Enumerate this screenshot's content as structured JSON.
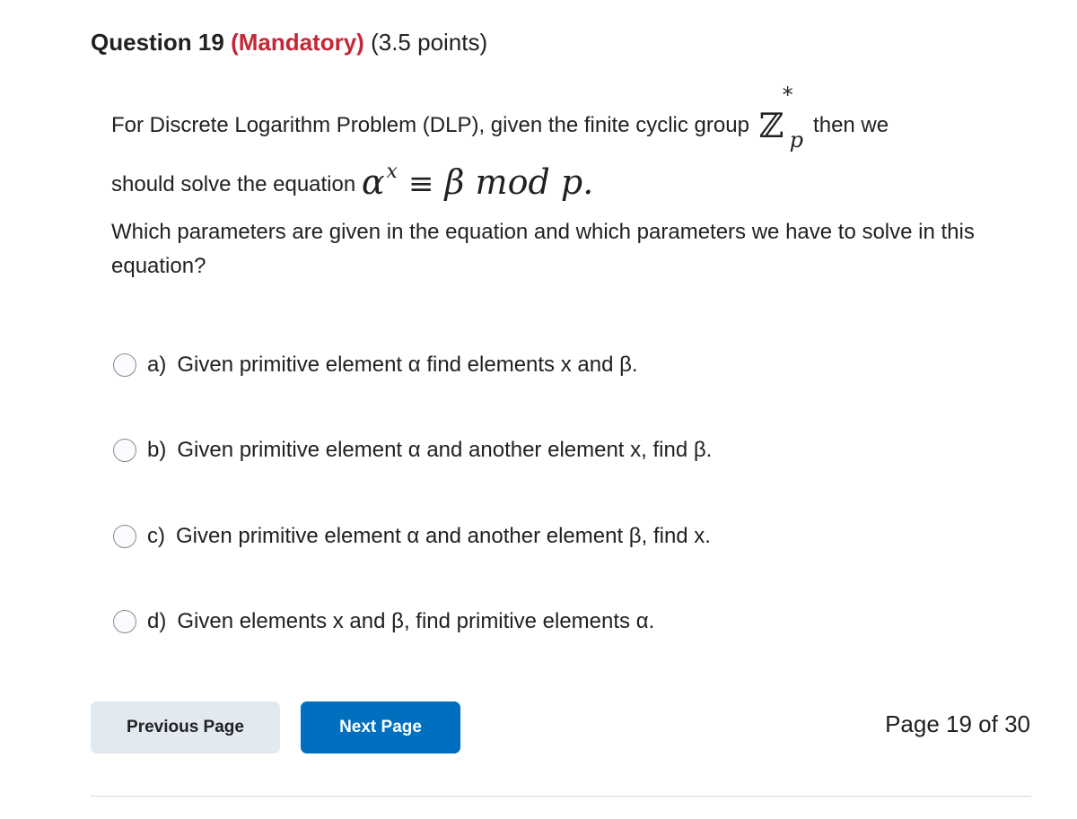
{
  "question": {
    "number_label": "Question 19",
    "mandatory_label": "(Mandatory)",
    "points_label": "(3.5 points)",
    "colors": {
      "mandatory": "#c42736",
      "text": "#202122"
    },
    "intro_text": "For Discrete Logarithm Problem (DLP), given  the finite cyclic group",
    "group_symbol": "ℤ",
    "group_superscript": "*",
    "group_subscript": "p",
    "intro_tail": "then we",
    "line2_text": "should solve the equation",
    "equation": {
      "base": "α",
      "exponent": "x",
      "relation": "≡",
      "rhs_beta": "β",
      "rhs_mod": "mod",
      "rhs_p": "p."
    },
    "prompt": "Which parameters are given in the equation and which parameters we have to solve in this equation?"
  },
  "options": [
    {
      "letter": "a)",
      "text": "Given primitive element α find elements x and β.",
      "selected": false
    },
    {
      "letter": "b)",
      "text": "Given primitive element α and another element x, find β.",
      "selected": false
    },
    {
      "letter": "c)",
      "text": "Given primitive element α and another element β, find x.",
      "selected": false
    },
    {
      "letter": "d)",
      "text": "Given elements x and β, find primitive elements α.",
      "selected": false
    }
  ],
  "navigation": {
    "previous_label": "Previous Page",
    "next_label": "Next Page",
    "page_indicator": "Page 19 of 30",
    "colors": {
      "previous_bg": "#e3e9f1",
      "next_bg": "#006fbf"
    }
  }
}
